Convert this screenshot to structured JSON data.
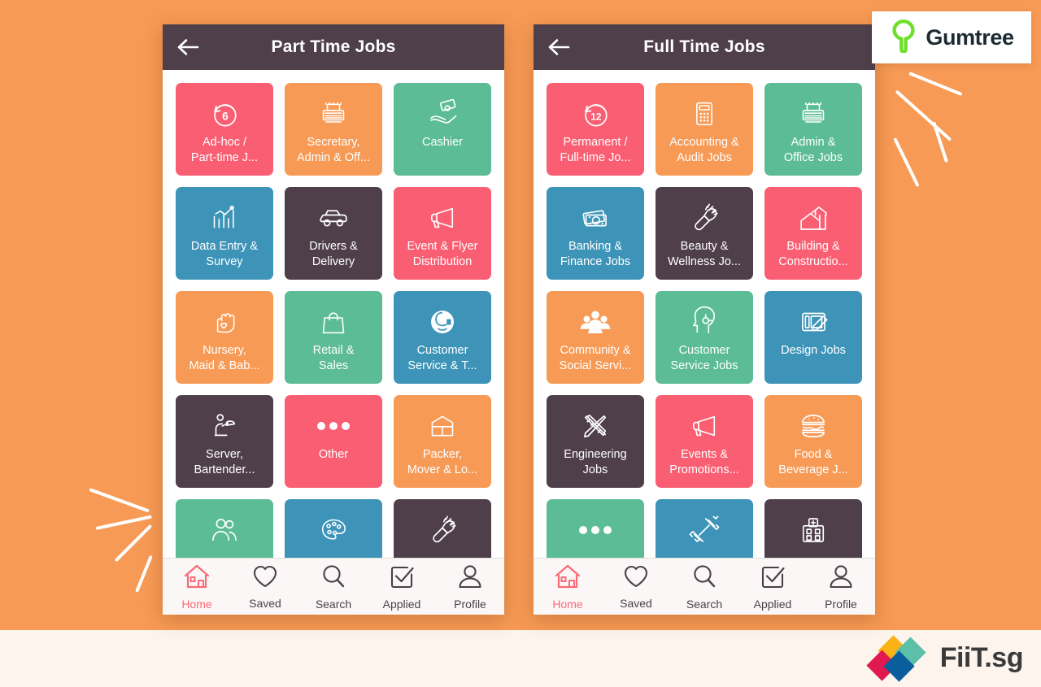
{
  "background": {
    "color": "#F79A55",
    "strip_color": "#FDF4EE"
  },
  "palette": {
    "pink": "#FA5E72",
    "orange": "#F79A55",
    "green": "#5CBC96",
    "blue": "#3D94B8",
    "dark": "#4E3F4A",
    "header": "#4E3F4A",
    "nav_active": "#FA6A78"
  },
  "brand": {
    "gumtree_name": "Gumtree",
    "gumtree_icon": "tree-icon",
    "gumtree_color": "#6EE02A",
    "fiit_name": "FiiT.sg",
    "fiit_colors": [
      "#FBB215",
      "#5CBFA8",
      "#E01A4F",
      "#0A5E9C"
    ]
  },
  "screens": [
    {
      "id": "part-time",
      "title": "Part Time Jobs",
      "back_icon": "back-arrow-icon",
      "tiles": [
        {
          "label": "Ad-hoc /\nPart-time J...",
          "color": "#FA5E72",
          "icon": "clock-6-icon"
        },
        {
          "label": "Secretary,\nAdmin & Off...",
          "color": "#F79A55",
          "icon": "typewriter-icon"
        },
        {
          "label": "Cashier",
          "color": "#5CBC96",
          "icon": "cash-hand-icon"
        },
        {
          "label": "Data Entry &\nSurvey",
          "color": "#3D94B8",
          "icon": "bar-chart-icon"
        },
        {
          "label": "Drivers &\nDelivery",
          "color": "#4E3F4A",
          "icon": "car-icon"
        },
        {
          "label": "Event & Flyer\nDistribution",
          "color": "#FA5E72",
          "icon": "megaphone-icon"
        },
        {
          "label": "Nursery,\nMaid & Bab...",
          "color": "#F79A55",
          "icon": "hand-heart-icon"
        },
        {
          "label": "Retail &\nSales",
          "color": "#5CBC96",
          "icon": "shopping-bag-icon"
        },
        {
          "label": "Customer\nService & T...",
          "color": "#3D94B8",
          "icon": "headset-agent-icon"
        },
        {
          "label": "Server,\nBartender...",
          "color": "#4E3F4A",
          "icon": "waiter-icon"
        },
        {
          "label": "Other",
          "color": "#FA5E72",
          "icon": "ellipsis-icon"
        },
        {
          "label": "Packer,\nMover & Lo...",
          "color": "#F79A55",
          "icon": "warehouse-icon"
        },
        {
          "label": "",
          "color": "#5CBC96",
          "icon": "two-people-icon"
        },
        {
          "label": "",
          "color": "#3D94B8",
          "icon": "paint-palette-icon"
        },
        {
          "label": "",
          "color": "#4E3F4A",
          "icon": "hairbrush-icon"
        }
      ]
    },
    {
      "id": "full-time",
      "title": "Full Time Jobs",
      "back_icon": "back-arrow-icon",
      "tiles": [
        {
          "label": "Permanent /\nFull-time Jo...",
          "color": "#FA5E72",
          "icon": "clock-12-icon"
        },
        {
          "label": "Accounting &\nAudit Jobs",
          "color": "#F79A55",
          "icon": "calculator-icon"
        },
        {
          "label": "Admin &\nOffice Jobs",
          "color": "#5CBC96",
          "icon": "typewriter-icon"
        },
        {
          "label": "Banking &\nFinance Jobs",
          "color": "#3D94B8",
          "icon": "banknotes-icon"
        },
        {
          "label": "Beauty &\nWellness Jo...",
          "color": "#4E3F4A",
          "icon": "hairbrush-icon"
        },
        {
          "label": "Building &\nConstructio...",
          "color": "#FA5E72",
          "icon": "houses-icon"
        },
        {
          "label": "Community &\nSocial Servi...",
          "color": "#F79A55",
          "icon": "people-group-icon"
        },
        {
          "label": "Customer\nService Jobs",
          "color": "#5CBC96",
          "icon": "headset-profile-icon"
        },
        {
          "label": "Design Jobs",
          "color": "#3D94B8",
          "icon": "graphic-tablet-icon"
        },
        {
          "label": "Engineering\nJobs",
          "color": "#4E3F4A",
          "icon": "ruler-pencil-icon"
        },
        {
          "label": "Events &\nPromotions...",
          "color": "#FA5E72",
          "icon": "megaphone-icon"
        },
        {
          "label": "Food &\nBeverage J...",
          "color": "#F79A55",
          "icon": "burger-icon"
        },
        {
          "label": "",
          "color": "#5CBC96",
          "icon": "ellipsis-icon"
        },
        {
          "label": "",
          "color": "#3D94B8",
          "icon": "dumbbell-icon"
        },
        {
          "label": "",
          "color": "#4E3F4A",
          "icon": "hospital-icon"
        }
      ]
    }
  ],
  "bottom_nav": [
    {
      "label": "Home",
      "icon": "home-icon",
      "active": true
    },
    {
      "label": "Saved",
      "icon": "heart-icon",
      "active": false
    },
    {
      "label": "Search",
      "icon": "search-icon",
      "active": false
    },
    {
      "label": "Applied",
      "icon": "checkbox-icon",
      "active": false
    },
    {
      "label": "Profile",
      "icon": "person-icon",
      "active": false
    }
  ]
}
